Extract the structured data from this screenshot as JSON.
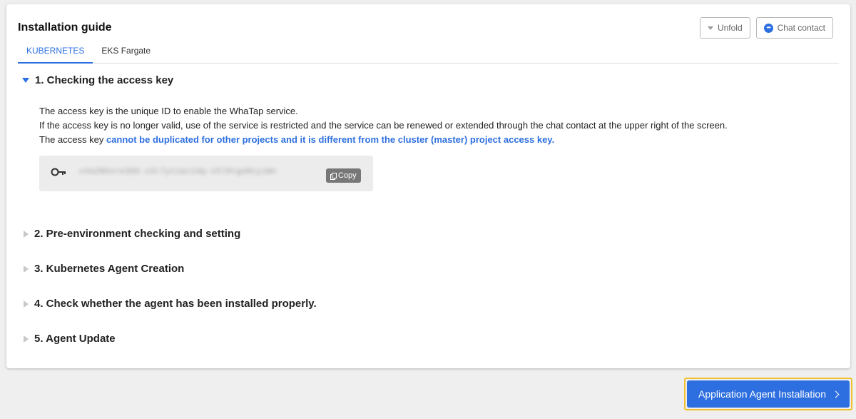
{
  "card": {
    "title": "Installation guide",
    "unfold_label": "Unfold",
    "chat_label": "Chat contact"
  },
  "tabs": [
    {
      "label": "KUBERNETES",
      "active": true
    },
    {
      "label": "EKS Fargate",
      "active": false
    }
  ],
  "sections": [
    {
      "title": "1. Checking the access key",
      "expanded": true
    },
    {
      "title": "2. Pre-environment checking and setting",
      "expanded": false
    },
    {
      "title": "3. Kubernetes Agent Creation",
      "expanded": false
    },
    {
      "title": "4. Check whether the agent has been installed properly.",
      "expanded": false
    },
    {
      "title": "5. Agent Update",
      "expanded": false
    }
  ],
  "access_key": {
    "line1": "The access key is the unique ID to enable the WhaTap service.",
    "line2": "If the access key is no longer valid, use of the service is restricted and the service can be renewed or extended through the chat contact at the upper right of the screen.",
    "line3_prefix": "The access key ",
    "line3_highlight": "cannot be duplicated for other projects and it is different from the cluster (master) project access key.",
    "key_value": "x4a2N5sre3G6-z3r7yt1ec1dq-v5l9tgaN1yiWn",
    "copy_label": "Copy"
  },
  "footer": {
    "next_button_label": "Application Agent Installation"
  },
  "colors": {
    "accent": "#2d6fe0",
    "highlight_border": "#f2bf2f"
  }
}
